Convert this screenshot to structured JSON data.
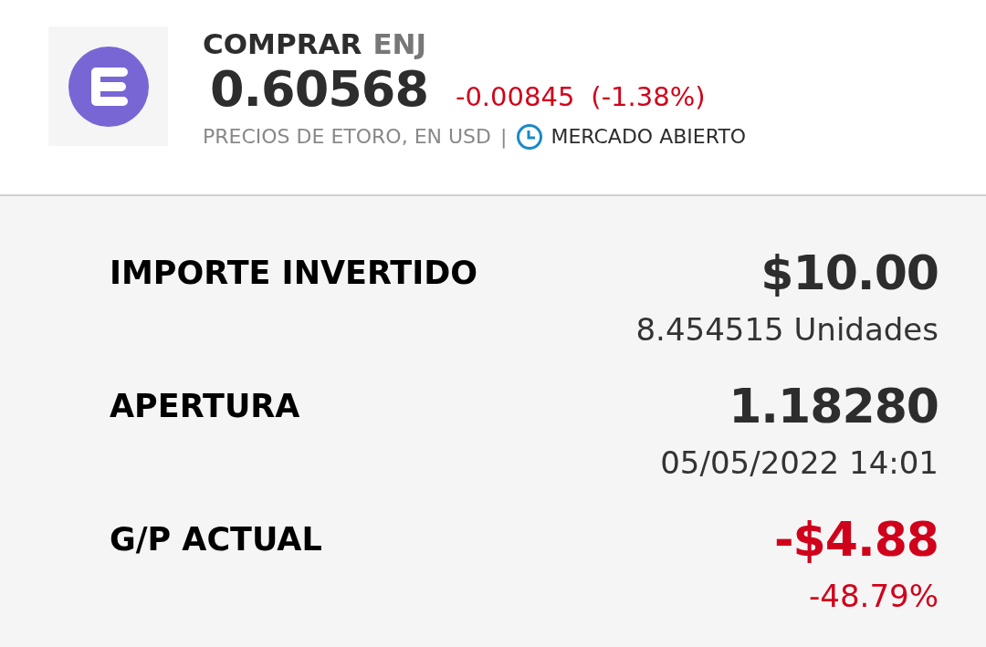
{
  "header": {
    "action": "COMPRAR",
    "symbol": "ENJ",
    "price": "0.60568",
    "change": "-0.00845",
    "change_percent": "(-1.38%)",
    "change_negative": true,
    "source": "PRECIOS DE ETORO, EN USD",
    "separator": "|",
    "market_status": "MERCADO ABIERTO"
  },
  "rows": [
    {
      "label": "IMPORTE INVERTIDO",
      "value": "$10.00",
      "detail": "8.454515 Unidades",
      "negative": false
    },
    {
      "label": "APERTURA",
      "value": "1.18280",
      "detail": "05/05/2022 14:01",
      "negative": false
    },
    {
      "label": "G/P ACTUAL",
      "value": "-$4.88",
      "detail": "-48.79%",
      "negative": true
    }
  ]
}
